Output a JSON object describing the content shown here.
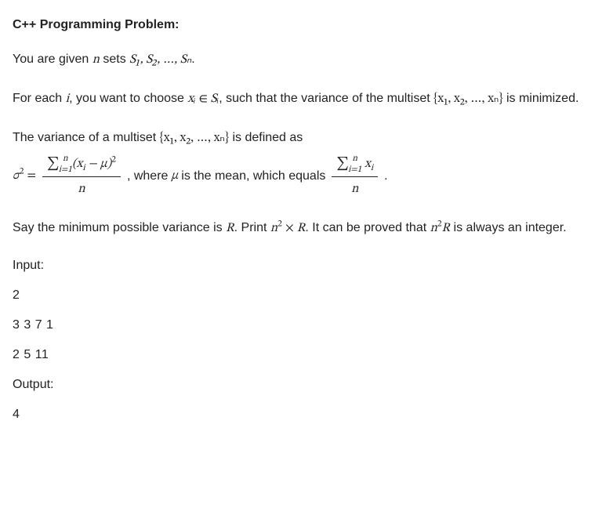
{
  "heading": "C++ Programming Problem:",
  "p1_a": "You are given ",
  "p1_n": "n",
  "p1_b": " sets ",
  "p1_sets": "S₁, S₂, …, Sₙ",
  "p1_c": ".",
  "p2_a": "For each ",
  "p2_i": "i",
  "p2_b": ", you want to choose ",
  "p2_xi": "xᵢ",
  "p2_in": " ∈ ",
  "p2_Si": "Sᵢ",
  "p2_c": ", such that the variance of the multiset ",
  "p2_set": "{x₁, x₂, …, xₙ}",
  "p2_d": " is minimized.",
  "p3_a": "The variance of a multiset ",
  "p3_set": "{x₁, x₂, …, xₙ}",
  "p3_b": " is defined as",
  "sigma2": "σ",
  "sq": "2",
  "eq": " = ",
  "sum_sym": "∑",
  "sum_lo": "i=1",
  "sum_hi": "n",
  "num_body_a": "(x",
  "num_body_i": "i",
  "num_body_b": " − μ)",
  "den_n": "n",
  "p3_c": ", where ",
  "mu": "μ",
  "p3_d": " is the mean, which equals ",
  "num2_x": "x",
  "num2_i": "i",
  "p3_e": ".",
  "p4_a": "Say the minimum possible variance is ",
  "R": "R",
  "p4_b": ". Print ",
  "n2R_n": "n",
  "n2R_times": " × ",
  "p4_c": ". It can be proved that ",
  "p4_d": " is always an integer.",
  "input_label": "Input:",
  "in_line1": "2",
  "in_line2": "3 3 7 1",
  "in_line3": "2 5 11",
  "output_label": "Output:",
  "out_line1": "4"
}
